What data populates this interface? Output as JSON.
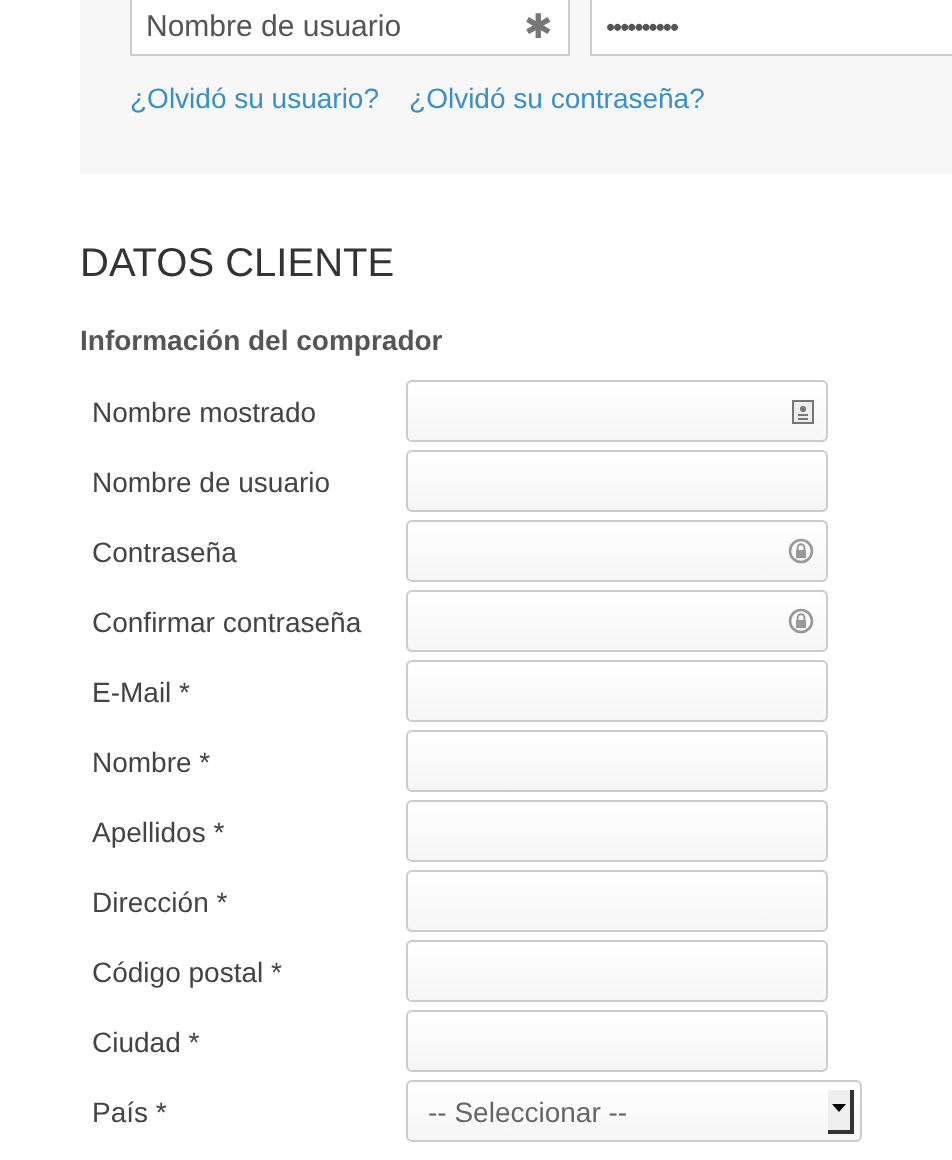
{
  "login": {
    "username": {
      "placeholder": "Nombre de usuario",
      "required_mark": "✱"
    },
    "password": {
      "value": "••••••••••"
    },
    "links": [
      "¿Olvidó su usuario?",
      "¿Olvidó su contraseña?"
    ]
  },
  "section": {
    "title": "DATOS CLIENTE",
    "subtitle": "Información del comprador",
    "fields": [
      {
        "label": "Nombre mostrado",
        "kind": "contact"
      },
      {
        "label": "Nombre de usuario",
        "kind": "text"
      },
      {
        "label": "Contraseña",
        "kind": "password"
      },
      {
        "label": "Confirmar contraseña",
        "kind": "password"
      },
      {
        "label": "E-Mail *",
        "kind": "text"
      },
      {
        "label": "Nombre *",
        "kind": "text"
      },
      {
        "label": "Apellidos *",
        "kind": "text"
      },
      {
        "label": "Dirección *",
        "kind": "text"
      },
      {
        "label": "Código postal *",
        "kind": "text"
      },
      {
        "label": "Ciudad *",
        "kind": "text"
      },
      {
        "label": "País *",
        "kind": "select",
        "value": "-- Seleccionar --"
      }
    ]
  }
}
